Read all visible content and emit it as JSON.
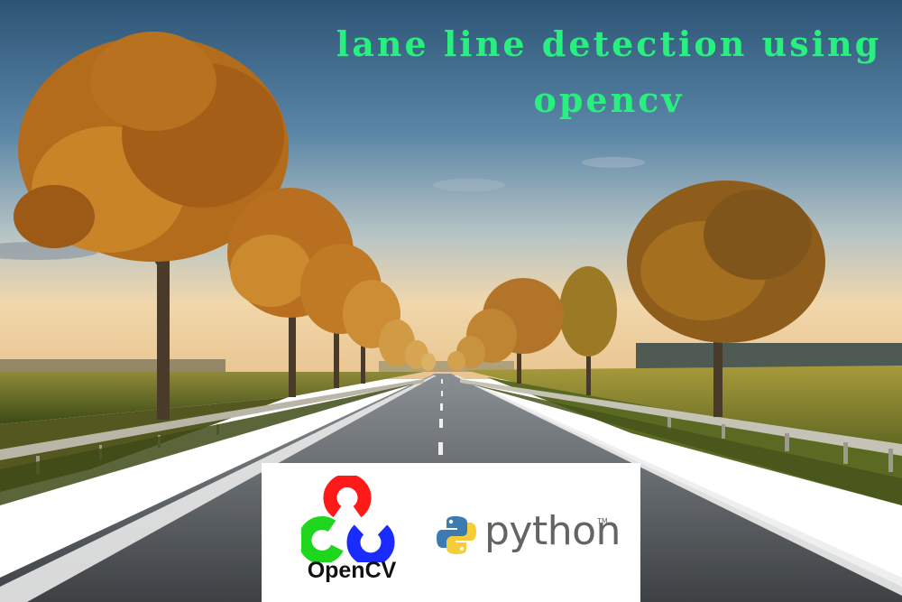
{
  "title": "lane line detection using opencv",
  "logos": {
    "opencv_label": "OpenCV",
    "python_label": "python",
    "python_tm": "TM"
  },
  "colors": {
    "title": "#27f07e",
    "sky_top": "#2f5878",
    "sky_horizon": "#f3d6a8",
    "foliage": "#c27a1c",
    "opencv_red": "#ff1a1a",
    "opencv_green": "#1ed61e",
    "opencv_blue": "#1a2bff",
    "python_blue": "#3d7ab0",
    "python_yellow": "#f5cc3a"
  },
  "icons": [
    "opencv-logo-icon",
    "python-logo-icon"
  ]
}
